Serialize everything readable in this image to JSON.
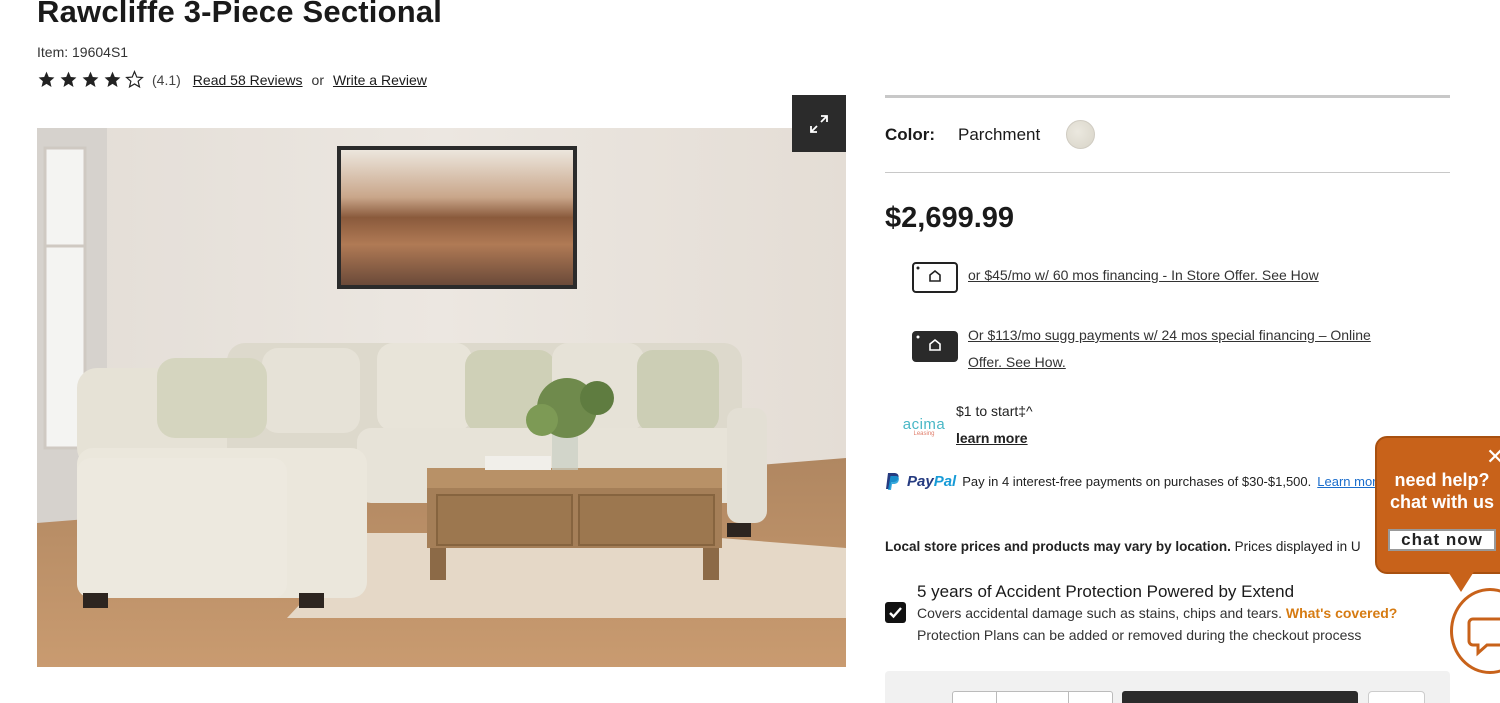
{
  "product": {
    "title": "Rawcliffe 3-Piece Sectional",
    "item_number": "Item: 19604S1",
    "rating_value": 4.1,
    "rating_text": "(4.1)",
    "reviews_link": "Read 58 Reviews",
    "or_text": "or",
    "write_review_link": "Write a Review"
  },
  "options": {
    "color_label": "Color:",
    "color_value": "Parchment",
    "swatch_color": "#e3e0d6"
  },
  "pricing": {
    "price": "$2,699.99",
    "financing_in_store": "or $45/mo w/ 60 mos financing - In Store Offer. See How",
    "financing_online_line1": "Or $113/mo sugg payments w/ 24 mos special financing – Online",
    "financing_online_line2": "Offer. See How.",
    "acima_logo": "acima",
    "acima_sub": "Leasing",
    "acima_text": "$1 to start‡^",
    "acima_learn": "learn more",
    "paypal_text": "Pay in 4 interest-free payments on purchases of $30-$1,500.",
    "paypal_learn": "Learn more",
    "store_note_bold": "Local store prices and products may vary by location.",
    "store_note_rest": "Prices displayed in U"
  },
  "protection": {
    "title": "5 years of Accident Protection Powered by Extend",
    "description": "Covers accidental damage such as stains, chips and tears.",
    "whats_covered": "What's covered?",
    "note": "Protection Plans can be added or removed during the checkout process",
    "checked": true
  },
  "chat": {
    "line1": "need help?",
    "line2": "chat with us",
    "button": "chat now",
    "close": "✕"
  },
  "colors": {
    "accent_orange": "#c8621a",
    "link_orange": "#d67b12",
    "paypal_blue": "#253b80",
    "paypal_light": "#179bd7",
    "acima_teal": "#49b7c6"
  }
}
